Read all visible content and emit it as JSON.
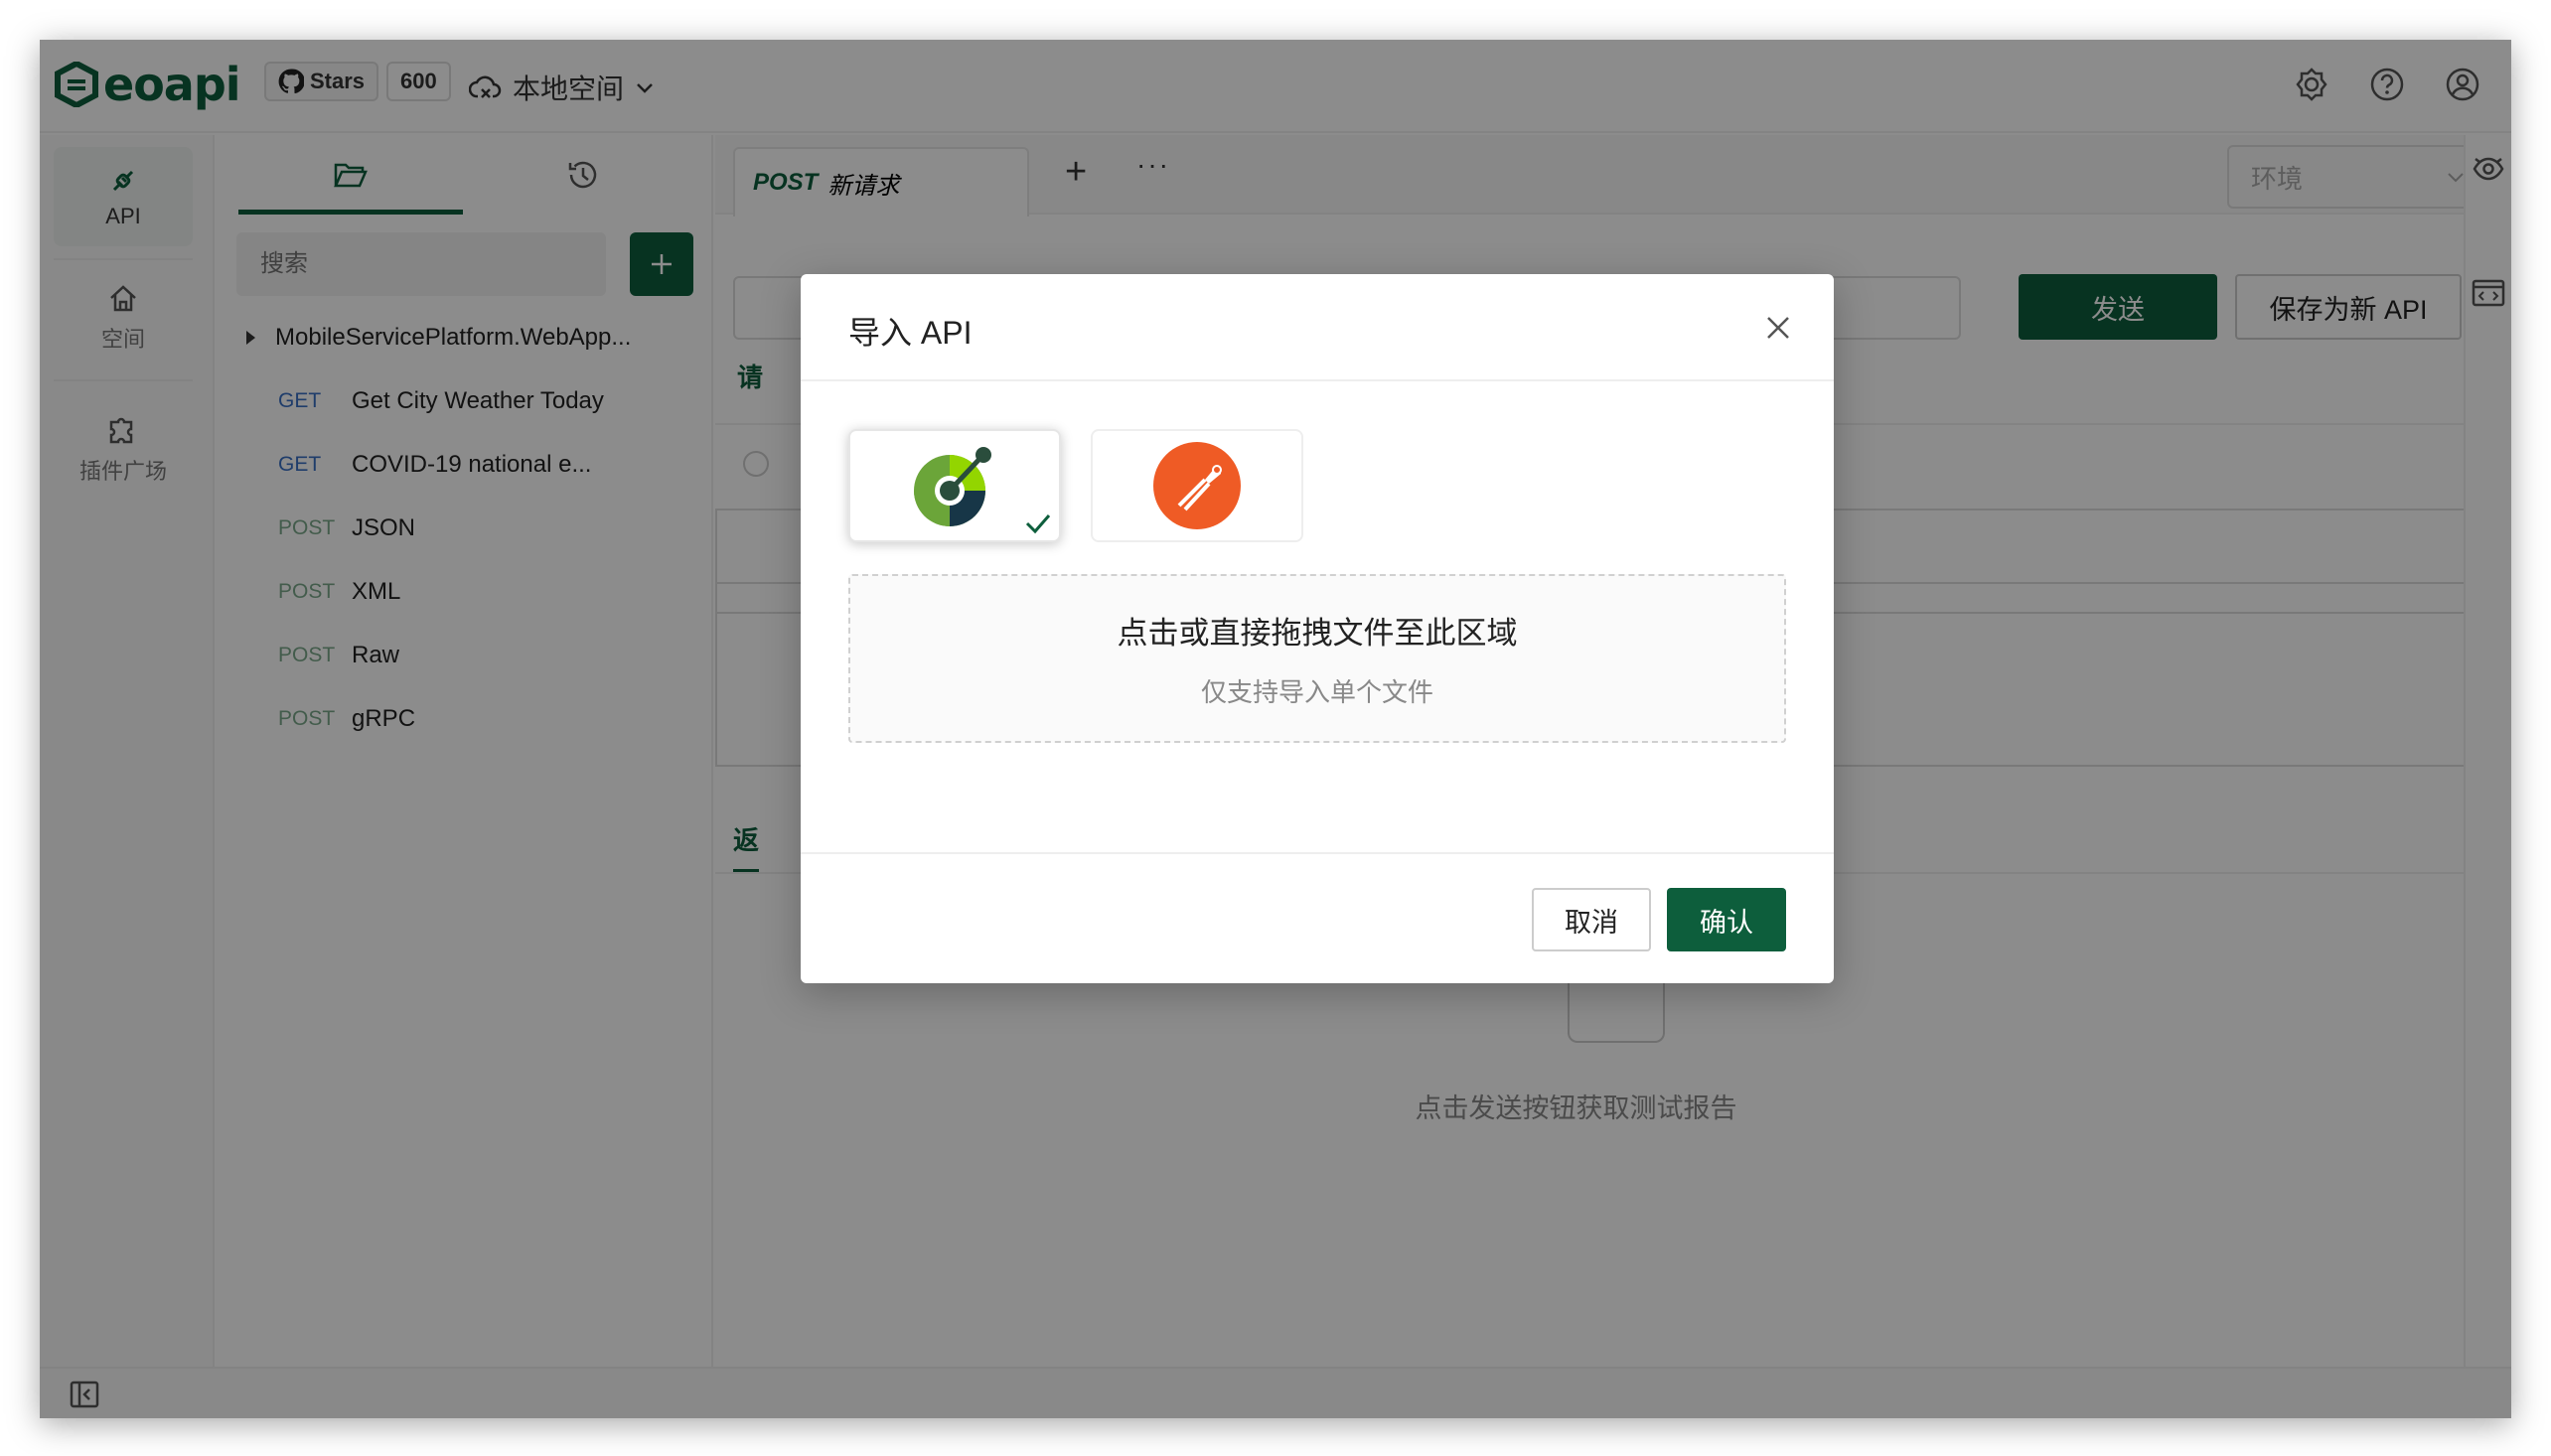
{
  "app": {
    "logo_text": "eoapi",
    "github": {
      "stars_label": "Stars",
      "stars_count": "600"
    },
    "workspace_label": "本地空间"
  },
  "leftnav": {
    "items": [
      {
        "label": "API",
        "icon": "api-icon"
      },
      {
        "label": "空间",
        "icon": "home-icon"
      },
      {
        "label": "插件广场",
        "icon": "puzzle-icon"
      }
    ]
  },
  "sidebar": {
    "search_placeholder": "搜索",
    "group": "MobileServicePlatform.WebApp...",
    "items": [
      {
        "method": "GET",
        "name": "Get City Weather Today"
      },
      {
        "method": "GET",
        "name": "COVID-19 national e..."
      },
      {
        "method": "POST",
        "name": "JSON"
      },
      {
        "method": "POST",
        "name": "XML"
      },
      {
        "method": "POST",
        "name": "Raw"
      },
      {
        "method": "POST",
        "name": "gRPC"
      }
    ]
  },
  "main": {
    "tab": {
      "method": "POST",
      "title": "新请求"
    },
    "env_placeholder": "环境",
    "send_label": "发送",
    "save_label": "保存为新 API",
    "request_label": "请",
    "response_label": "返",
    "empty_text": "点击发送按钮获取测试报告"
  },
  "modal": {
    "title": "导入 API",
    "formats": [
      {
        "name": "openapi-format",
        "selected": true
      },
      {
        "name": "postman-format",
        "selected": false
      }
    ],
    "dropzone_title": "点击或直接拖拽文件至此区域",
    "dropzone_hint": "仅支持导入单个文件",
    "cancel_label": "取消",
    "confirm_label": "确认"
  },
  "colors": {
    "brand": "#0d5e3c",
    "get": "#3a6fc4",
    "post": "#7aa88a",
    "postman": "#ef5b25"
  }
}
